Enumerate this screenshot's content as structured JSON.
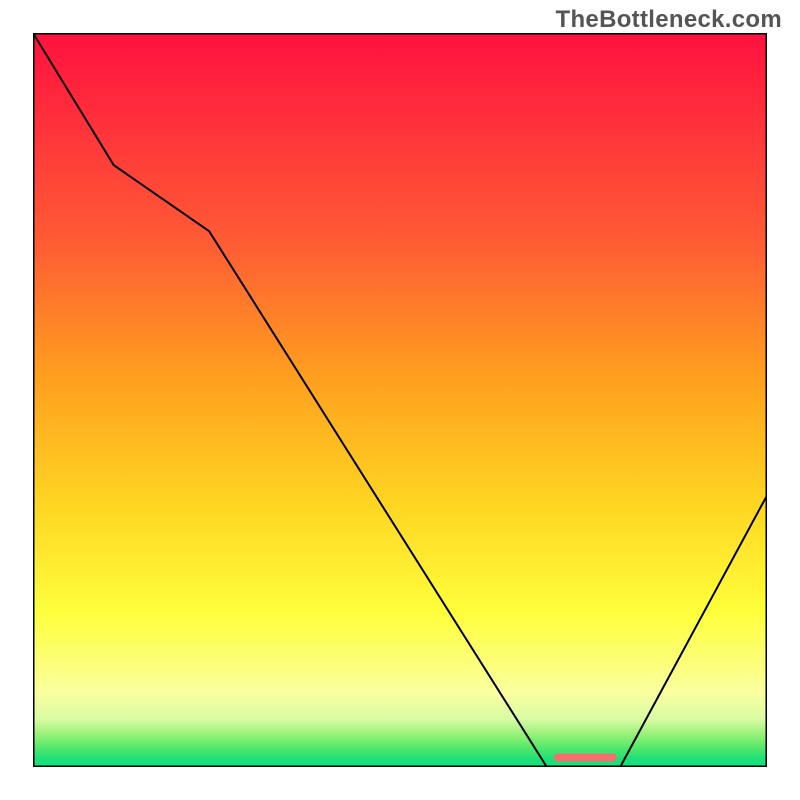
{
  "watermark": "TheBottleneck.com",
  "chart_data": {
    "type": "line",
    "title": "",
    "xlabel": "",
    "ylabel": "",
    "xlim": [
      0,
      100
    ],
    "ylim": [
      0,
      100
    ],
    "legend": false,
    "axes_visible": {
      "ticks": false,
      "labels": false,
      "border": true
    },
    "series": [
      {
        "name": "curve",
        "x": [
          0.0,
          11.0,
          24.0,
          70.0,
          80.0,
          100.0
        ],
        "y": [
          100.0,
          82.0,
          73.0,
          0.0,
          0.0,
          37.0
        ],
        "stroke": "#000000",
        "stroke_width": 2
      },
      {
        "name": "marker-segment",
        "x": [
          71.5,
          79.0
        ],
        "y": [
          1.3,
          1.3
        ],
        "stroke": "#f66e6e",
        "stroke_width": 8,
        "linecap": "round"
      }
    ],
    "background_gradient": {
      "type": "linear-vertical",
      "stops": [
        {
          "offset": 0.0,
          "color": "#ff113f"
        },
        {
          "offset": 0.28,
          "color": "#ff5a35"
        },
        {
          "offset": 0.46,
          "color": "#ff9c1f"
        },
        {
          "offset": 0.64,
          "color": "#ffd522"
        },
        {
          "offset": 0.79,
          "color": "#ffff3b"
        },
        {
          "offset": 0.9,
          "color": "#faffa0"
        },
        {
          "offset": 0.935,
          "color": "#d9fca5"
        },
        {
          "offset": 0.955,
          "color": "#9af179"
        },
        {
          "offset": 0.975,
          "color": "#4fe86a"
        },
        {
          "offset": 0.99,
          "color": "#1ae07a"
        },
        {
          "offset": 1.0,
          "color": "#1ae080"
        }
      ]
    }
  }
}
